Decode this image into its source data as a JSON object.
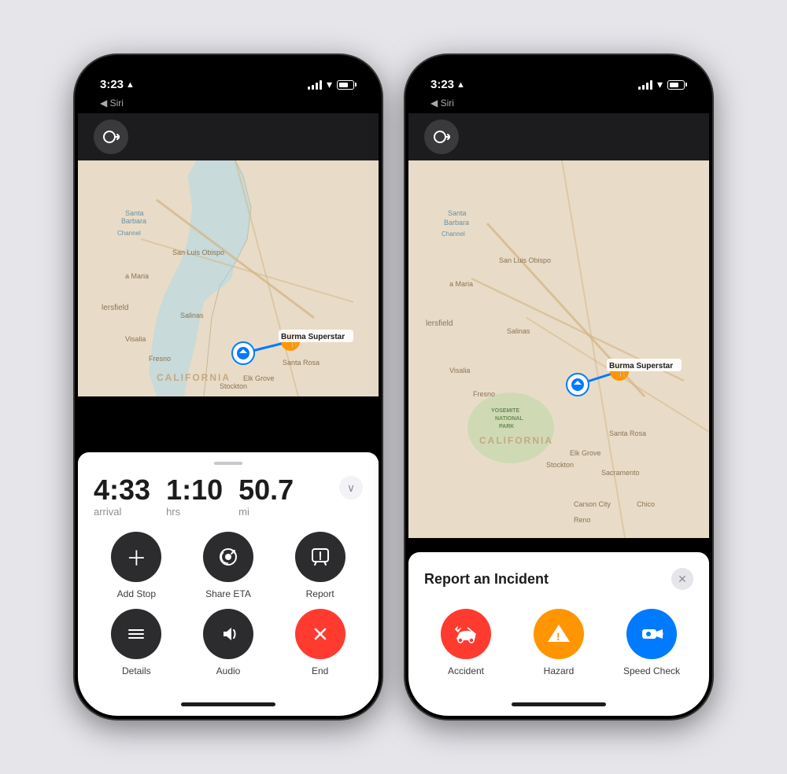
{
  "phone1": {
    "status": {
      "time": "3:23",
      "location_arrow": "▲",
      "siri_label": "◀ Siri"
    },
    "nav": {
      "arrival_time": "4:33",
      "arrival_label": "arrival",
      "duration": "1:10",
      "duration_label": "hrs",
      "distance": "50.7",
      "distance_label": "mi"
    },
    "actions": [
      {
        "id": "add-stop",
        "label": "Add Stop",
        "icon": "+",
        "style": "dark"
      },
      {
        "id": "share-eta",
        "label": "Share ETA",
        "icon": "share",
        "style": "dark"
      },
      {
        "id": "report",
        "label": "Report",
        "icon": "report",
        "style": "dark"
      },
      {
        "id": "details",
        "label": "Details",
        "icon": "list",
        "style": "dark"
      },
      {
        "id": "audio",
        "label": "Audio",
        "icon": "audio",
        "style": "dark"
      },
      {
        "id": "end",
        "label": "End",
        "icon": "×",
        "style": "red"
      }
    ],
    "destination": "Burma Superstar"
  },
  "phone2": {
    "status": {
      "time": "3:23",
      "siri_label": "◀ Siri"
    },
    "incident": {
      "title": "Report an Incident",
      "close_label": "×",
      "options": [
        {
          "id": "accident",
          "label": "Accident",
          "icon": "🚗",
          "style": "accident"
        },
        {
          "id": "hazard",
          "label": "Hazard",
          "icon": "⚠",
          "style": "hazard"
        },
        {
          "id": "speed-check",
          "label": "Speed Check",
          "icon": "📷",
          "style": "speed"
        }
      ]
    },
    "destination": "Burma Superstar"
  }
}
